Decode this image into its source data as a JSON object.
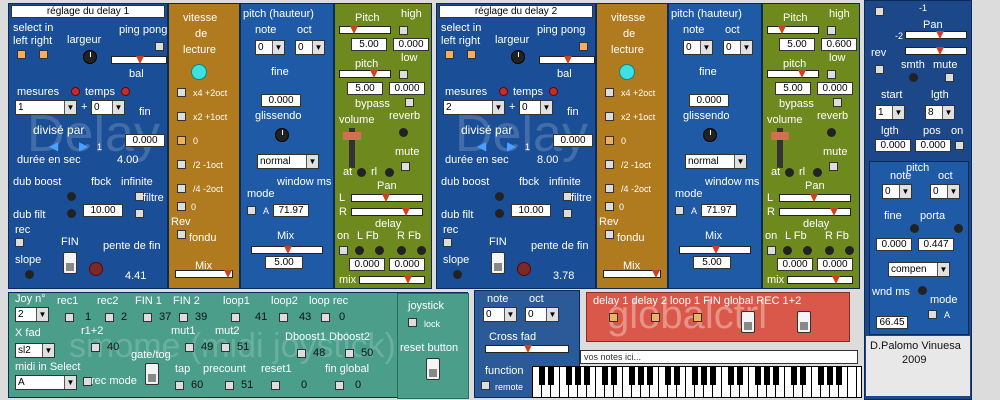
{
  "delay1": {
    "header": "réglage du delay 1",
    "select_in": "select in",
    "left_right": "left right",
    "largeur": "largeur",
    "ping_pong": "ping pong",
    "bal": "bal",
    "mesures": "mesures",
    "temps": "temps",
    "mesures_value": "1",
    "temps_value": "0",
    "plus": "+",
    "fin": "fin",
    "fin_value": "0.000",
    "divise_par": "divisé par",
    "divise_value": "1",
    "duree_en_sec": "durée en sec",
    "duree_value": "4.00",
    "dub_boost": "dub boost",
    "fbck": "fbck",
    "infinite": "infinite",
    "dub_filt": "dub filt",
    "fbck_value": "10.00",
    "filtre": "filtre",
    "rec": "rec",
    "slope": "slope",
    "fin_label": "FIN",
    "pente_de_fin": "pente de fin",
    "pente_value": "4.41",
    "watermark": "Delay 1",
    "vitesse": "vitesse",
    "de": "de",
    "lecture": "lecture",
    "x4": "x4 +2oct",
    "x2": "x2 +1oct",
    "zero": "0",
    "div2": "/2 -1oct",
    "div4": "/4 -2oct",
    "zero2": "0",
    "rev": "Rev",
    "fondu": "fondu",
    "mix": "Mix",
    "pitch_hauteur": "pitch (hauteur)",
    "note": "note",
    "oct": "oct",
    "note_value": "0",
    "oct_value": "0",
    "fine": "fine",
    "fine_value": "0.000",
    "glissendo": "glissendo",
    "mode_value": "normal",
    "window_ms": "window ms",
    "mode": "mode",
    "a_label": "A",
    "window_value": "71.97",
    "mix2": "Mix",
    "mix_value": "5.00",
    "pitch": "Pitch",
    "high": "high",
    "pitch_value": "5.00",
    "high_value": "0.000",
    "low": "low",
    "pitch2": "pitch",
    "pitch2_value": "5.00",
    "low_value": "0.000",
    "bypass": "bypass",
    "volume": "volume",
    "reverb": "reverb",
    "mute": "mute",
    "at": "at",
    "rl": "rl",
    "pan": "Pan",
    "L": "L",
    "R": "R",
    "delay": "delay",
    "on": "on",
    "lfb": "L  Fb",
    "rfb": "R  Fb",
    "delay_l_value": "0.000",
    "delay_r_value": "0.000",
    "mix3": "mix"
  },
  "delay2": {
    "header": "réglage du delay 2",
    "select_in": "select in",
    "left_right": "left right",
    "largeur": "largeur",
    "ping_pong": "ping pong",
    "bal": "bal",
    "mesures": "mesures",
    "temps": "temps",
    "mesures_value": "2",
    "temps_value": "0",
    "plus": "+",
    "fin": "fin",
    "fin_value": "0.000",
    "divise_par": "divisé par",
    "divise_value": "1",
    "duree_en_sec": "durée en sec",
    "duree_value": "8.00",
    "dub_boost": "dub boost",
    "fbck": "fbck",
    "infinite": "infinite",
    "dub_filt": "dub filt",
    "fbck_value": "10.00",
    "filtre": "filtre",
    "rec": "rec",
    "slope": "slope",
    "fin_label": "FIN",
    "pente_de_fin": "pente de fin",
    "pente_value": "3.78",
    "watermark": "Delay 2",
    "vitesse": "vitesse",
    "de": "de",
    "lecture": "lecture",
    "x4": "x4 +2oct",
    "x2": "x2 +1oct",
    "zero": "0",
    "div2": "/2 -1oct",
    "div4": "/4 -2oct",
    "zero2": "0",
    "rev": "Rev",
    "fondu": "fondu",
    "mix": "Mix",
    "pitch_hauteur": "pitch (hauteur)",
    "note": "note",
    "oct": "oct",
    "note_value": "0",
    "oct_value": "0",
    "fine": "fine",
    "fine_value": "0.000",
    "glissendo": "glissendo",
    "mode_value": "normal",
    "window_ms": "window ms",
    "mode": "mode",
    "a_label": "A",
    "window_value": "71.97",
    "mix2": "Mix",
    "mix_value": "5.00",
    "pitch": "Pitch",
    "high": "high",
    "pitch_value": "5.00",
    "high_value": "0.600",
    "low": "low",
    "pitch2": "pitch",
    "pitch2_value": "5.00",
    "low_value": "0.000",
    "bypass": "bypass",
    "volume": "volume",
    "reverb": "reverb",
    "mute": "mute",
    "at": "at",
    "rl": "rl",
    "pan": "Pan",
    "L": "L",
    "R": "R",
    "delay": "delay",
    "on": "on",
    "lfb": "L  Fb",
    "rfb": "R  Fb",
    "delay_l_value": "0.000",
    "delay_r_value": "0.000",
    "mix3": "mix"
  },
  "right": {
    "m1": "-1",
    "m2": "-2",
    "pan": "Pan",
    "rev": "rev",
    "smth": "smth",
    "mute": "mute",
    "start": "start",
    "lgth": "lgth",
    "start_value": "1",
    "lgth_value": "8",
    "lgth2": "lgth",
    "pos": "pos",
    "on": "on",
    "lgth_num": "0.000",
    "pos_num": "0.000",
    "pitch": "pitch",
    "note": "note",
    "oct": "oct",
    "note_value": "0",
    "oct_value": "0",
    "fine": "fine",
    "porta": "porta",
    "fine_value": "0.000",
    "porta_value": "0.447",
    "compen": "compen",
    "wnd_ms": "wnd ms",
    "mode": "mode",
    "wnd_value": "66.45",
    "a_label": "A"
  },
  "joystick": {
    "joy_n": "Joy n°",
    "joy_value": "2",
    "rec1": "rec1",
    "rec2": "rec2",
    "fin1": "FIN 1",
    "fin2": "FIN 2",
    "loop1": "loop1",
    "loop2": "loop2",
    "loop_rec": "loop rec",
    "v1": "1",
    "v2": "2",
    "v37": "37",
    "v39": "39",
    "v41": "41",
    "v43": "43",
    "v0": "0",
    "x_fad": "X fad",
    "r1r2": "r1+2",
    "v40": "40",
    "mut1": "mut1",
    "mut2": "mut2",
    "dboost1": "Dboost1",
    "dboost2": "Dboost2",
    "sl2": "sl2",
    "v49": "49",
    "v51": "51",
    "v48": "48",
    "v50": "50",
    "gate_tog": "gate/tog",
    "midi_in_select": "midi in Select",
    "rec_mode": "rec mode",
    "tap": "tap",
    "precount": "precount",
    "reset1": "reset1",
    "fin_global": "fin global",
    "select_value": "A",
    "v60": "60",
    "v51b": "51",
    "v0b": "0",
    "v0c": "0",
    "joystick": "joystick",
    "lock": "lock",
    "reset_button": "reset button",
    "watermark": "smome (midi joystick)"
  },
  "crossfade": {
    "note": "note",
    "oct": "oct",
    "note_value": "0",
    "oct_value": "0",
    "cross_fad": "Cross fad",
    "function": "function",
    "remote": "remote"
  },
  "global": {
    "labels": "delay 1 delay 2  loop 1  FIN global  REC 1+2",
    "watermark": "globalctrl",
    "credit": "D.Palomo Vinuesa",
    "year": "2009",
    "notes_placeholder": "vos notes ici..."
  }
}
